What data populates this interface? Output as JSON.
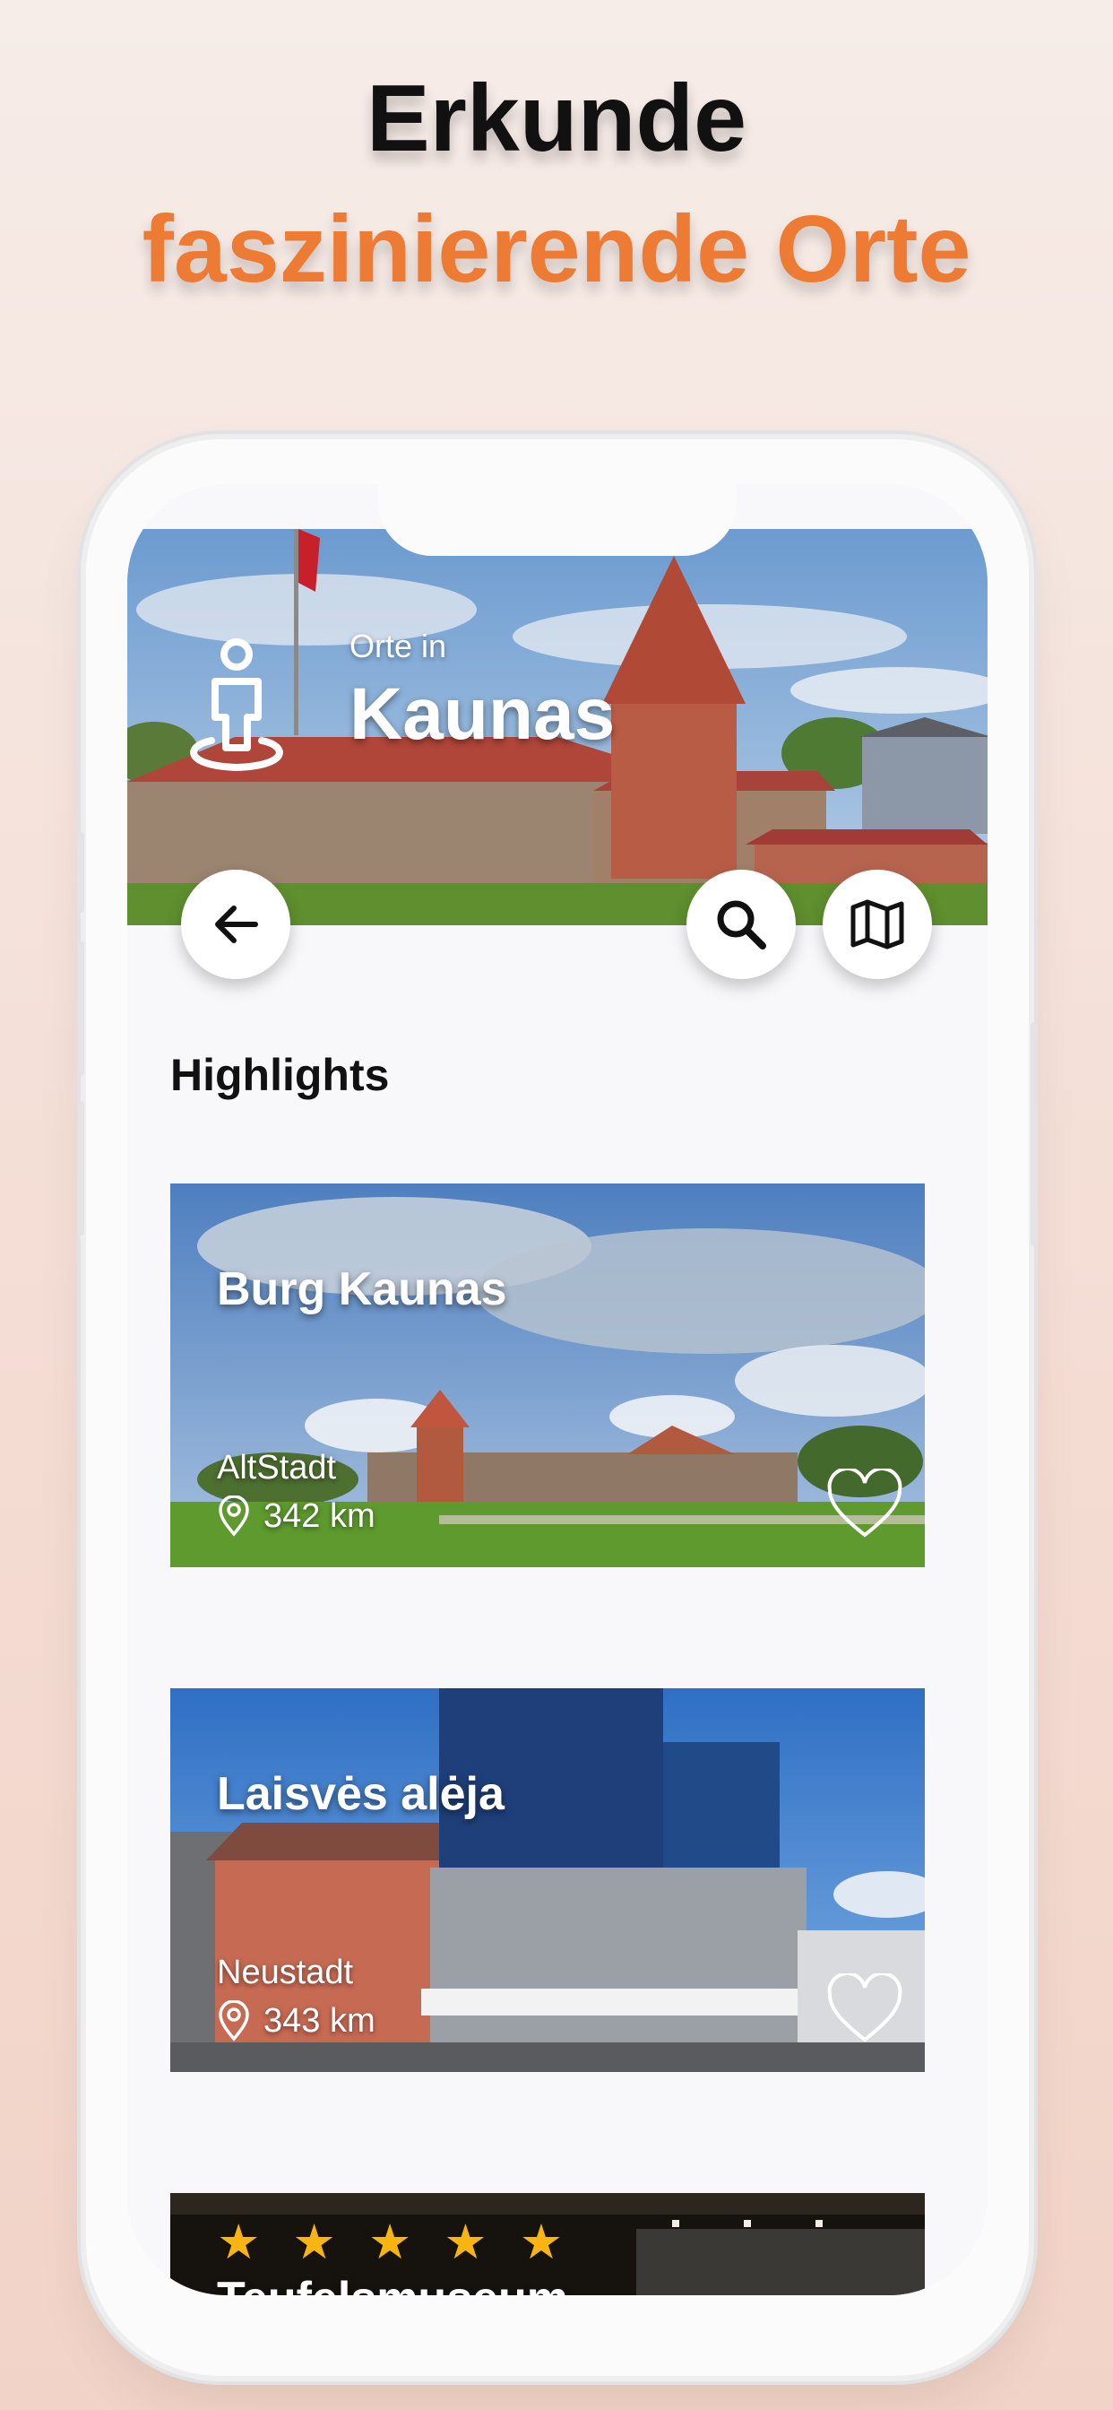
{
  "promo": {
    "line1": "Erkunde",
    "line2": "faszinierende Orte"
  },
  "header": {
    "subtitle": "Orte in",
    "city": "Kaunas"
  },
  "actions": {
    "back_icon": "arrow-left-icon",
    "search_icon": "search-icon",
    "map_icon": "map-icon"
  },
  "section": {
    "title": "Highlights"
  },
  "places": [
    {
      "name": "Burg Kaunas",
      "district": "AltStadt",
      "distance": "342 km"
    },
    {
      "name": "Laisvės alėja",
      "district": "Neustadt",
      "distance": "343 km"
    },
    {
      "name": "Teufelsmuseum",
      "rating": 5
    }
  ],
  "colors": {
    "accent": "#ee7b34",
    "star": "#f8b511"
  }
}
